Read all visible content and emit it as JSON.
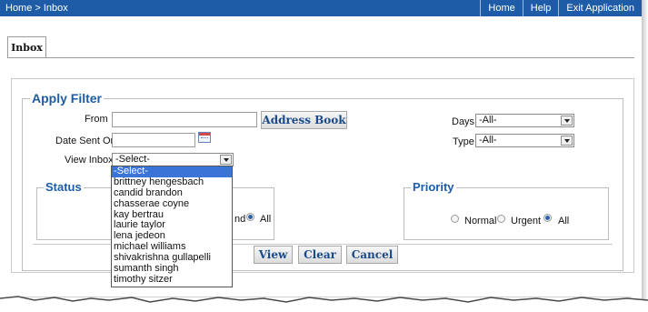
{
  "topbar": {
    "breadcrumb": "Home > Inbox",
    "links": [
      "Home",
      "Help",
      "Exit Application"
    ]
  },
  "tab": {
    "label": "Inbox"
  },
  "filter": {
    "title": "Apply Filter",
    "from_label": "From",
    "from_value": "",
    "address_book_label": "Address Book",
    "date_sent_label": "Date Sent On",
    "date_sent_value": "",
    "view_inbox_label": "View Inbox",
    "view_inbox_value": "-Select-",
    "days_label": "Days",
    "days_value": "-All-",
    "type_label": "Type",
    "type_value": "-All-"
  },
  "dropdown": {
    "options": [
      "-Select-",
      "brittney hengesbach",
      "candid brandon",
      "chasserae coyne",
      "kay bertrau",
      "laurie taylor",
      "lena jedeon",
      "michael williams",
      "shivakrishna gullapelli",
      "sumanth singh",
      "timothy sitzer"
    ],
    "selected_index": 0
  },
  "status": {
    "title": "Status",
    "partial_label": "nd",
    "all_label": "All",
    "selected": "All"
  },
  "priority": {
    "title": "Priority",
    "options": [
      "Normal",
      "Urgent",
      "All"
    ],
    "selected": "All"
  },
  "actions": {
    "view_label": "View",
    "clear_label": "Clear",
    "cancel_label": "Cancel"
  },
  "colors": {
    "topbar": "#1f5ca8",
    "legend": "#1f5ca8",
    "selected_option": "#3a74d6"
  }
}
